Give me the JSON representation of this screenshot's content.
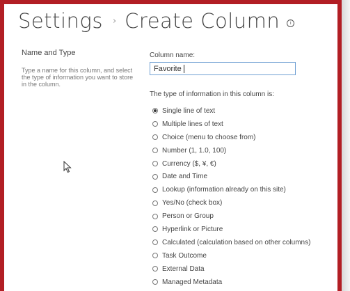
{
  "page": {
    "title_part1": "Settings",
    "separator": "›",
    "title_part2": "Create Column",
    "info_icon": "i"
  },
  "name_type": {
    "heading": "Name and Type",
    "description": "Type a name for this column, and select the type of information you want to store in the column.",
    "column_name_label": "Column name:",
    "column_name_value": "Favorite",
    "type_label": "The type of information in this column is:"
  },
  "types": [
    {
      "label": "Single line of text",
      "checked": true
    },
    {
      "label": "Multiple lines of text",
      "checked": false
    },
    {
      "label": "Choice (menu to choose from)",
      "checked": false
    },
    {
      "label": "Number (1, 1.0, 100)",
      "checked": false
    },
    {
      "label": "Currency ($, ¥, €)",
      "checked": false
    },
    {
      "label": "Date and Time",
      "checked": false
    },
    {
      "label": "Lookup (information already on this site)",
      "checked": false
    },
    {
      "label": "Yes/No (check box)",
      "checked": false
    },
    {
      "label": "Person or Group",
      "checked": false
    },
    {
      "label": "Hyperlink or Picture",
      "checked": false
    },
    {
      "label": "Calculated (calculation based on other columns)",
      "checked": false
    },
    {
      "label": "Task Outcome",
      "checked": false
    },
    {
      "label": "External Data",
      "checked": false
    },
    {
      "label": "Managed Metadata",
      "checked": false
    }
  ],
  "colors": {
    "frame": "#b21e24",
    "input_border": "#6f9fd3"
  }
}
